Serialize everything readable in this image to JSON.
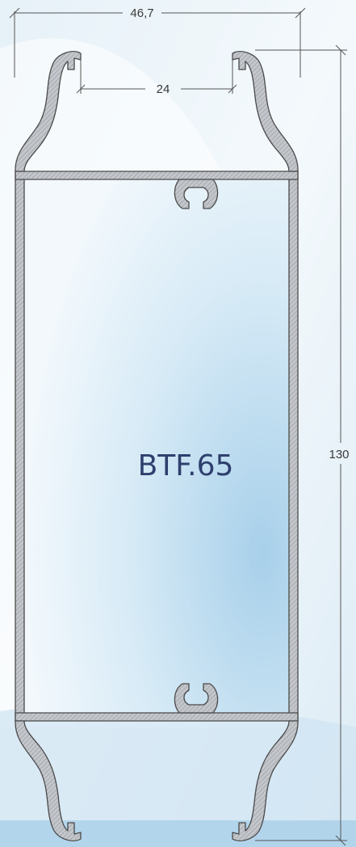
{
  "drawing": {
    "product_code": "BTF.65",
    "dimensions": {
      "overall_width": "46,7",
      "opening_width": "24",
      "height": "130"
    }
  },
  "colors": {
    "profile_fill": "#b9bcc1",
    "profile_stroke": "#4a4a4a",
    "dimension_line": "#555555",
    "title": "#2e3f6e",
    "background_light": "#eef6fb",
    "background_blue": "#b7d9ee"
  }
}
